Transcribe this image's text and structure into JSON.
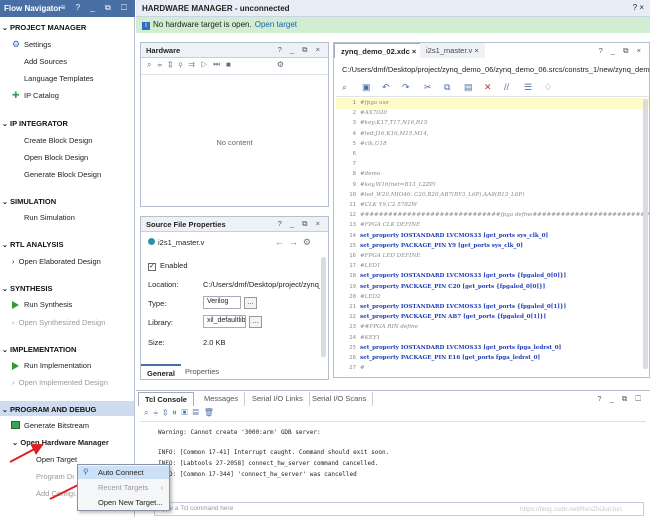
{
  "flow_navigator": {
    "title": "Flow Navigator",
    "title_controls": "≡ ? _ ⧉ ☐",
    "sections": {
      "project_manager": {
        "title": "PROJECT MANAGER",
        "items": [
          "Settings",
          "Add Sources",
          "Language Templates",
          "IP Catalog"
        ]
      },
      "ip_integrator": {
        "title": "IP INTEGRATOR",
        "items": [
          "Create Block Design",
          "Open Block Design",
          "Generate Block Design"
        ]
      },
      "simulation": {
        "title": "SIMULATION",
        "items": [
          "Run Simulation"
        ]
      },
      "rtl_analysis": {
        "title": "RTL ANALYSIS",
        "items": [
          "Open Elaborated Design"
        ]
      },
      "synthesis": {
        "title": "SYNTHESIS",
        "items": [
          "Run Synthesis",
          "Open Synthesized Design"
        ]
      },
      "implementation": {
        "title": "IMPLEMENTATION",
        "items": [
          "Run Implementation",
          "Open Implemented Design"
        ]
      },
      "program_debug": {
        "title": "PROGRAM AND DEBUG",
        "items": [
          "Generate Bitstream",
          "Open Hardware Manager",
          "Open Target",
          "Program Device",
          "Add Configuration Memory Device"
        ]
      }
    }
  },
  "hardware_manager": {
    "title": "HARDWARE MANAGER - unconnected",
    "title_controls": "? ×",
    "banner_text": "No hardware target is open.",
    "banner_link": "Open target"
  },
  "hardware_panel": {
    "title": "Hardware",
    "controls": "? _ ⧉ ×",
    "empty_text": "No content"
  },
  "source_file_properties": {
    "title": "Source File Properties",
    "controls": "? _ ⧉ ×",
    "file_name": "i2s1_master.v",
    "enabled_label": "Enabled",
    "location_label": "Location:",
    "location_value": "C:/Users/dmf/Desktop/project/zynq_demo",
    "type_label": "Type:",
    "type_value": "Verilog",
    "library_label": "Library:",
    "library_value": "xil_defaultlib",
    "size_label": "Size:",
    "size_value": "2.0 KB",
    "tabs": [
      "General",
      "Properties"
    ]
  },
  "editor": {
    "tabs": [
      "zynq_demo_02.xdc",
      "i2s1_master.v"
    ],
    "controls": "? _ ⧉ ×",
    "path": "C:/Users/dmf/Desktop/project/zynq_demo_06/zynq_demo_06.srcs/constrs_1/new/zynq_demo_02.xdc",
    "code_lines": [
      {
        "n": "1",
        "t": "#fpga use",
        "c": "cm"
      },
      {
        "n": "2",
        "t": "#AX7020",
        "c": "cm"
      },
      {
        "n": "3",
        "t": "#key:K17,T17,N16,R15",
        "c": "cm"
      },
      {
        "n": "4",
        "t": "#led:J16,K16,M15,M14,",
        "c": "cm"
      },
      {
        "n": "5",
        "t": "#clk,U18",
        "c": "cm"
      },
      {
        "n": "6",
        "t": "",
        "c": ""
      },
      {
        "n": "7",
        "t": "",
        "c": ""
      },
      {
        "n": "8",
        "t": "#demo",
        "c": "cm"
      },
      {
        "n": "9",
        "t": "#key,W16(net=B13_L2ZP)",
        "c": "cm"
      },
      {
        "n": "10",
        "t": "#led_W20,MIO46: C20,B20,AB7(BY3_L6P),AA8(B13_L6P)",
        "c": "cm"
      },
      {
        "n": "11",
        "t": "#CLK Y9,C2 5782W",
        "c": "cm"
      },
      {
        "n": "12",
        "t": "##############################fpga define###############################",
        "c": "cm"
      },
      {
        "n": "13",
        "t": "#FPGA CLK DEFINE",
        "c": "cm"
      },
      {
        "n": "14",
        "t": "set_property IOSTANDARD LVCMOS33 [get_ports sys_clk_0]",
        "c": "kw"
      },
      {
        "n": "15",
        "t": "set_property PACKAGE_PIN Y9 [get_ports sys_clk_0]",
        "c": "kw"
      },
      {
        "n": "16",
        "t": "#FPGA LED DEFINE",
        "c": "cm"
      },
      {
        "n": "17",
        "t": "#LED1",
        "c": "cm"
      },
      {
        "n": "18",
        "t": "set_property IOSTANDARD LVCMOS33 [get_ports {fpgaled_0[0]}]",
        "c": "kw"
      },
      {
        "n": "19",
        "t": "set_property PACKAGE_PIN C20 [get_ports {fpgaled_0[0]}]",
        "c": "kw"
      },
      {
        "n": "20",
        "t": "#LED2",
        "c": "cm"
      },
      {
        "n": "21",
        "t": "set_property IOSTANDARD LVCMOS33 [get_ports {fpgaled_0[1]}]",
        "c": "kw"
      },
      {
        "n": "22",
        "t": "set_property PACKAGE_PIN AB7 [get_ports {fpgaled_0[1]}]",
        "c": "kw"
      },
      {
        "n": "23",
        "t": "##FPGA RIN define",
        "c": "cm"
      },
      {
        "n": "24",
        "t": "#KEY1",
        "c": "cm"
      },
      {
        "n": "25",
        "t": "set_property IOSTANDARD LVCMOS33 [get_ports fpga_ledrst_0]",
        "c": "kw"
      },
      {
        "n": "26",
        "t": "set_property PACKAGE_PIN E16 [get_ports fpga_ledrst_0]",
        "c": "kw"
      },
      {
        "n": "27",
        "t": "#",
        "c": "cm"
      }
    ]
  },
  "tcl_console": {
    "tabs": [
      "Tcl Console",
      "Messages",
      "Serial I/O Links",
      "Serial I/O Scans"
    ],
    "controls": "? _ ⧉ ☐",
    "lines": [
      "Warning: Cannot create '3000:arm' GDB server:",
      "",
      "INFO: [Common 17-41] Interrupt caught. Command should exit soon.",
      "INFO: [Labtools 27-2058] connect_hw_server command cancelled.",
      "INFO: [Common 17-344] 'connect_hw_server' was cancelled"
    ],
    "input_placeholder": "Type a Tcl command here"
  },
  "context_menu": {
    "items": [
      "Auto Connect",
      "Recent Targets",
      "Open New Target..."
    ]
  },
  "watermark": "https://blog.csdn.net/RenZhiJunJun"
}
